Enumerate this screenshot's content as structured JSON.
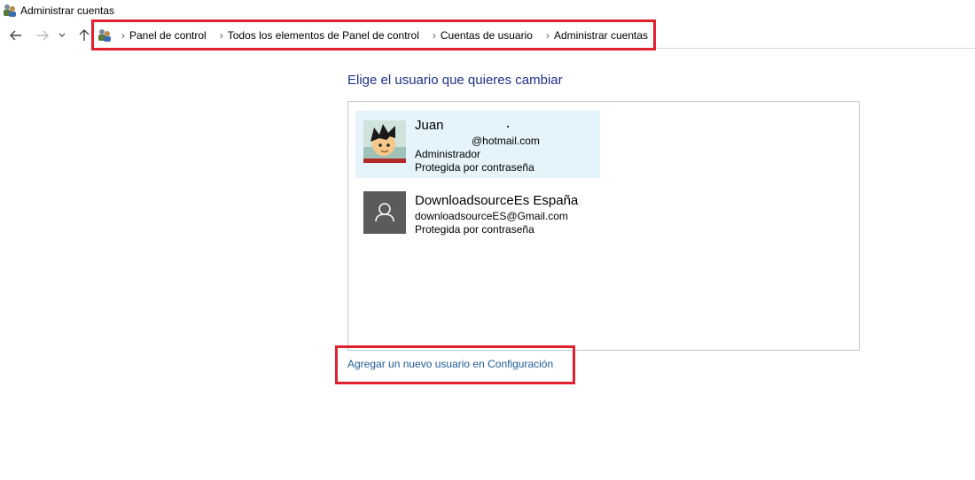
{
  "window": {
    "title": "Administrar cuentas",
    "icon": "user-accounts-icon"
  },
  "nav": {
    "back_icon": "arrow-left-icon",
    "forward_icon": "arrow-right-icon",
    "recent_icon": "chevron-down-icon",
    "up_icon": "arrow-up-icon",
    "breadcrumbs": [
      "Panel de control",
      "Todos los elementos de Panel de control",
      "Cuentas de usuario",
      "Administrar cuentas"
    ]
  },
  "main": {
    "heading": "Elige el usuario que quieres cambiar",
    "users": [
      {
        "name": "Juan",
        "email": "@hotmail.com",
        "role": "Administrador",
        "protection": "Protegida por contraseña",
        "selected": true
      },
      {
        "name": "DownloadsourceEs España",
        "email": "downloadsourceES@Gmail.com",
        "protection": "Protegida por contraseña",
        "selected": false
      }
    ],
    "add_user_link": "Agregar un nuevo usuario en Configuración"
  },
  "colors": {
    "highlight": "#e0222e",
    "link": "#1f5a96",
    "heading": "#1e3287",
    "selected_bg": "#e5f3fb"
  }
}
